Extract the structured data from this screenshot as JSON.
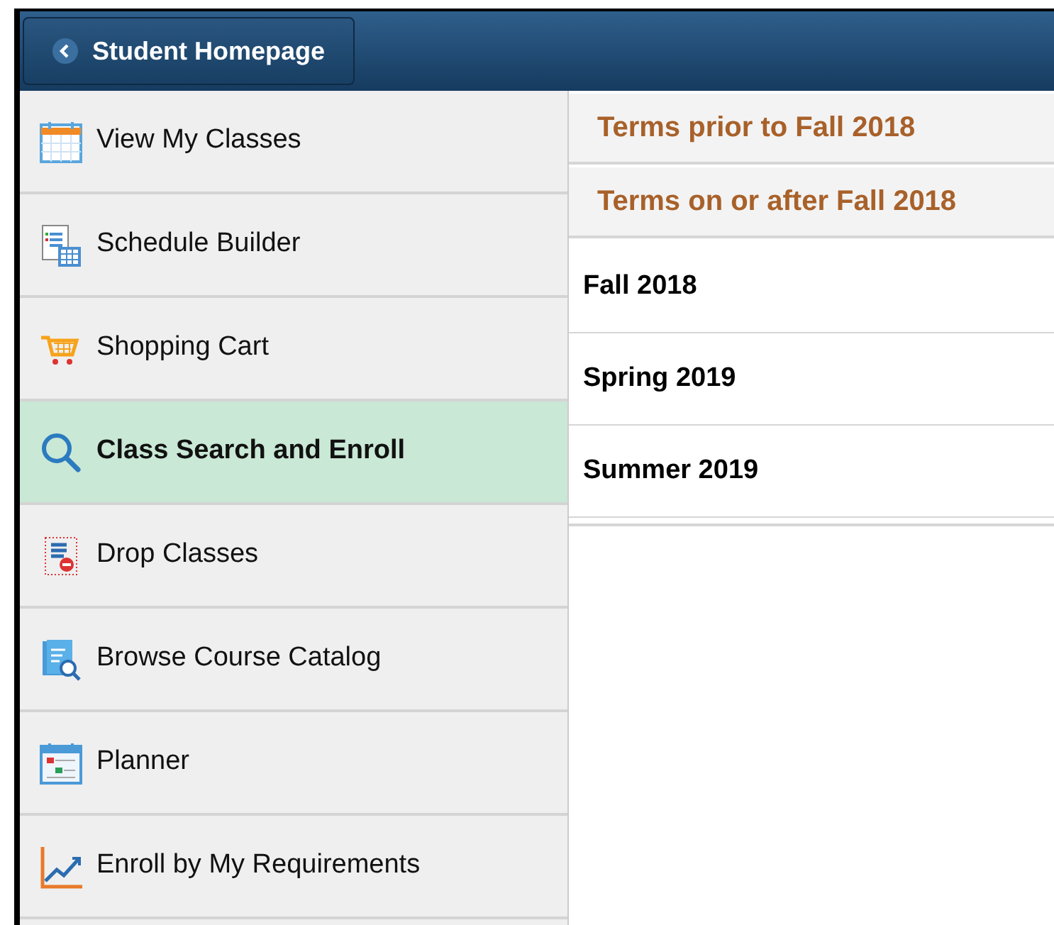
{
  "header": {
    "back_button": {
      "label": "Student Homepage"
    }
  },
  "sidebar": {
    "items": [
      {
        "label": "View My Classes",
        "kind": "calendar",
        "selected": false
      },
      {
        "label": "Schedule Builder",
        "kind": "schedule",
        "selected": false
      },
      {
        "label": "Shopping Cart",
        "kind": "cart",
        "selected": false
      },
      {
        "label": "Class Search and Enroll",
        "kind": "search",
        "selected": true
      },
      {
        "label": "Drop Classes",
        "kind": "drop",
        "selected": false
      },
      {
        "label": "Browse Course Catalog",
        "kind": "catalog",
        "selected": false
      },
      {
        "label": "Planner",
        "kind": "planner",
        "selected": false
      },
      {
        "label": "Enroll by My Requirements",
        "kind": "chart",
        "selected": false
      }
    ]
  },
  "term_groups": [
    {
      "label": "Terms prior to Fall 2018"
    },
    {
      "label": "Terms on or after Fall 2018"
    }
  ],
  "terms": [
    {
      "label": "Fall 2018"
    },
    {
      "label": "Spring 2019"
    },
    {
      "label": "Summer 2019"
    }
  ]
}
